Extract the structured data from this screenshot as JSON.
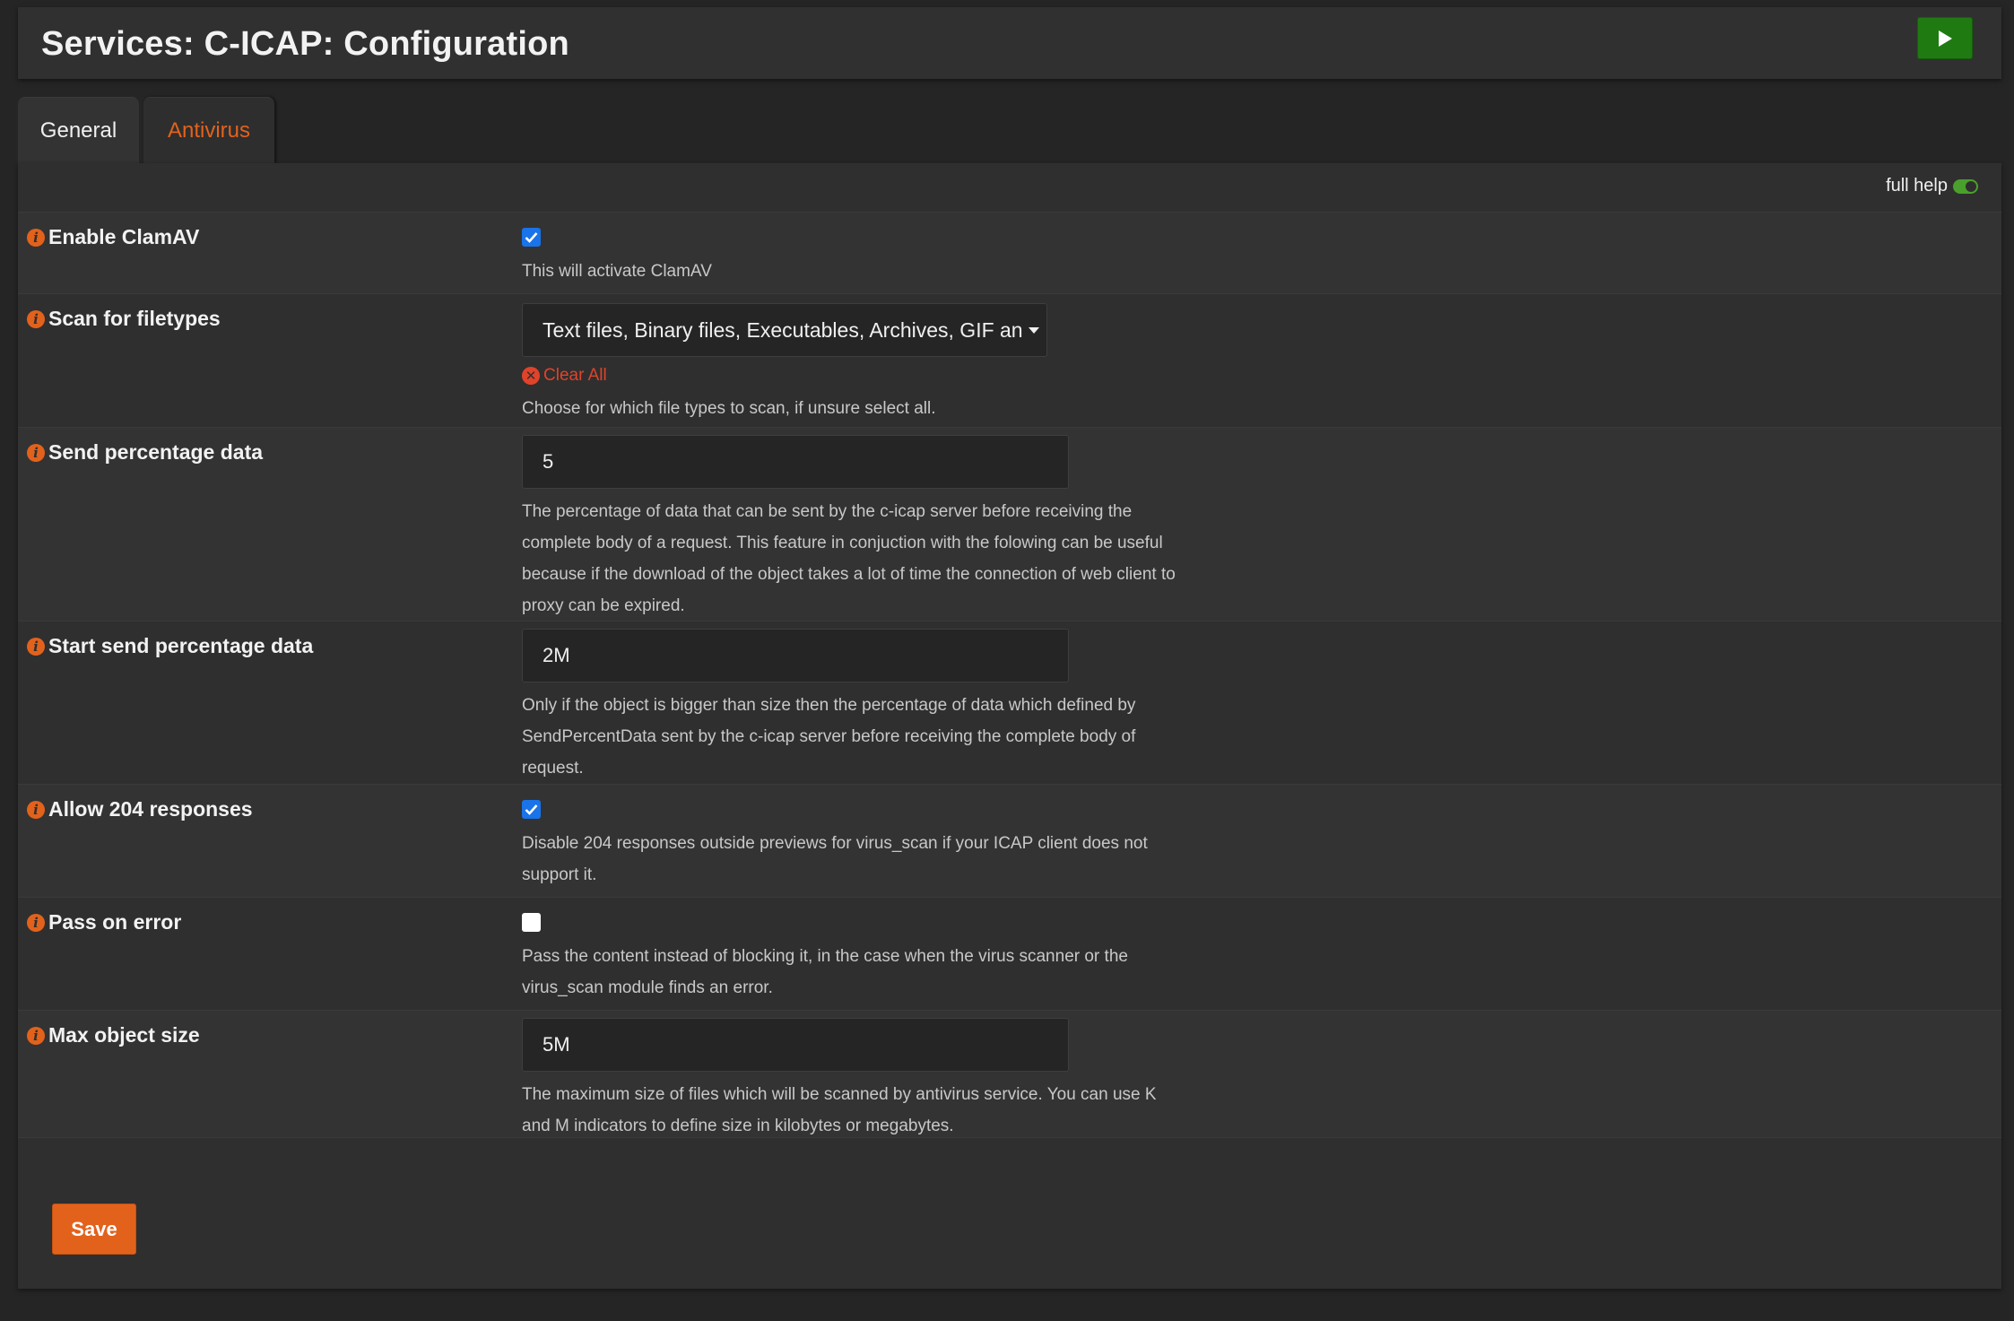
{
  "header": {
    "title": "Services: C-ICAP: Configuration",
    "run_icon": "play-icon"
  },
  "tabs": [
    {
      "label": "General",
      "active": false
    },
    {
      "label": "Antivirus",
      "active": true
    }
  ],
  "full_help": {
    "label": "full help",
    "enabled": true
  },
  "fields": {
    "enable_clamav": {
      "label": "Enable ClamAV",
      "checked": true,
      "help": "This will activate ClamAV"
    },
    "scan_filetypes": {
      "label": "Scan for filetypes",
      "value": "Text files, Binary files, Executables, Archives, GIF an",
      "clear_label": "Clear All",
      "help": "Choose for which file types to scan, if unsure select all."
    },
    "send_percentage": {
      "label": "Send percentage data",
      "value": "5",
      "help": "The percentage of data that can be sent by the c-icap server before receiving the complete body of a request. This feature in conjuction with the folowing can be useful because if the download of the object takes a lot of time the connection of web client to proxy can be expired."
    },
    "start_send_percentage": {
      "label": "Start send percentage data",
      "value": "2M",
      "help": "Only if the object is bigger than size then the percentage of data which defined by SendPercentData sent by the c-icap server before receiving the complete body of request."
    },
    "allow_204": {
      "label": "Allow 204 responses",
      "checked": true,
      "help": "Disable 204 responses outside previews for virus_scan if your ICAP client does not support it."
    },
    "pass_on_error": {
      "label": "Pass on error",
      "checked": false,
      "help": "Pass the content instead of blocking it, in the case when the virus scanner or the virus_scan module finds an error."
    },
    "max_object_size": {
      "label": "Max object size",
      "value": "5M",
      "help": "The maximum size of files which will be scanned by antivirus service. You can use K and M indicators to define size in kilobytes or megabytes."
    }
  },
  "save_label": "Save",
  "colors": {
    "accent": "#e2621c",
    "run_button": "#1f7a12",
    "checkbox": "#1a73e8",
    "danger": "#e0432a"
  }
}
